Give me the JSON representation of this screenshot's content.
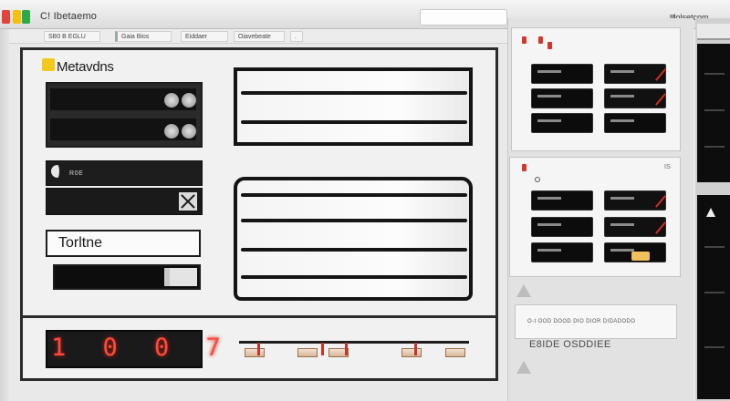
{
  "window": {
    "title": "C! Ibetaemo",
    "right_label": "Iolsetcom"
  },
  "toolbar": {
    "items": [
      "SB0 B EGLU",
      "Gaia Bios",
      "Eiddaer",
      "Oiavebeate",
      "."
    ]
  },
  "main": {
    "heading": "Metavdns",
    "subpanel_label": "R0E",
    "text_input_value": "Torltne",
    "digit_display": "1 0 0 7"
  },
  "right_panel": {
    "status_text": "IS",
    "caption_line": "O-t OOD DOOD DIO DIOR DIDADODO",
    "caption_large": "E8IDE OSDDIEE"
  },
  "colors": {
    "accent_red": "#d92a1f",
    "digit_red": "#ff4a3a",
    "badge_yellow": "#f2c81a",
    "dark_fill": "#0d0d0d"
  }
}
